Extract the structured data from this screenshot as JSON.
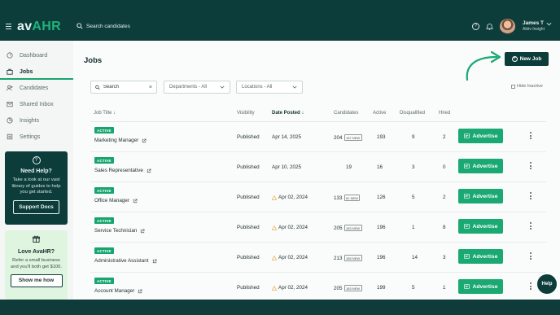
{
  "app": {
    "logo_prefix": "av",
    "logo_suffix": "AHR"
  },
  "topbar": {
    "search_placeholder": "Search candidates",
    "user_name": "James T",
    "user_org": "Aktiv Insight"
  },
  "sidebar": {
    "items": [
      {
        "label": "Dashboard",
        "icon": "dashboard-icon"
      },
      {
        "label": "Jobs",
        "icon": "briefcase-icon",
        "active": true
      },
      {
        "label": "Candidates",
        "icon": "users-icon"
      },
      {
        "label": "Shared Inbox",
        "icon": "inbox-icon"
      },
      {
        "label": "Insights",
        "icon": "insights-icon"
      },
      {
        "label": "Settings",
        "icon": "settings-icon"
      }
    ],
    "help_card": {
      "title": "Need Help?",
      "text": "Take a look at our vast library of guides to help you get started.",
      "button": "Support Docs"
    },
    "love_card": {
      "title": "Love AvaHR?",
      "text": "Refer a small business and you'll both get $100.",
      "button": "Show me how"
    }
  },
  "main": {
    "title": "Jobs",
    "new_job_label": "New Job",
    "filters": {
      "search_value": "Search",
      "departments": "Departments - All",
      "locations": "Locations - All",
      "hide_inactive": "Hide Inactive"
    },
    "columns": {
      "job_title": "Job Title",
      "visibility": "Visibility",
      "date_posted": "Date Posted",
      "candidates": "Candidates",
      "active": "Active",
      "disqualified": "Disqualified",
      "hired": "Hired"
    },
    "advertise_label": "Advertise",
    "rows": [
      {
        "status": "ACTIVE",
        "title": "Marketing Manager",
        "visibility": "Published",
        "date": "Apr 14, 2025",
        "warn": false,
        "candidates": "204",
        "new": "157 NEW",
        "active": "193",
        "disqualified": "9",
        "hired": "2"
      },
      {
        "status": "ACTIVE",
        "title": "Sales Representative",
        "visibility": "Published",
        "date": "Apr 10, 2025",
        "warn": false,
        "candidates": "19",
        "new": "",
        "active": "16",
        "disqualified": "3",
        "hired": "0"
      },
      {
        "status": "ACTIVE",
        "title": "Office Manager",
        "visibility": "Published",
        "date": "Apr 02, 2024",
        "warn": true,
        "candidates": "133",
        "new": "81 NEW",
        "active": "126",
        "disqualified": "5",
        "hired": "2"
      },
      {
        "status": "ACTIVE",
        "title": "Service Technician",
        "visibility": "Published",
        "date": "Apr 02, 2024",
        "warn": true,
        "candidates": "205",
        "new": "183 NEW",
        "active": "196",
        "disqualified": "1",
        "hired": "8"
      },
      {
        "status": "ACTIVE",
        "title": "Administrative Assistant",
        "visibility": "Published",
        "date": "Apr 02, 2024",
        "warn": true,
        "candidates": "213",
        "new": "185 NEW",
        "active": "196",
        "disqualified": "14",
        "hired": "3"
      },
      {
        "status": "ACTIVE",
        "title": "Account Manager",
        "visibility": "Published",
        "date": "Apr 02, 2024",
        "warn": true,
        "candidates": "205",
        "new": "183 NEW",
        "active": "199",
        "disqualified": "5",
        "hired": "1"
      }
    ]
  },
  "help_bubble": "Help",
  "colors": {
    "brand_dark": "#0d3d3b",
    "accent_green": "#1aa873",
    "warn": "#e8a33a"
  }
}
